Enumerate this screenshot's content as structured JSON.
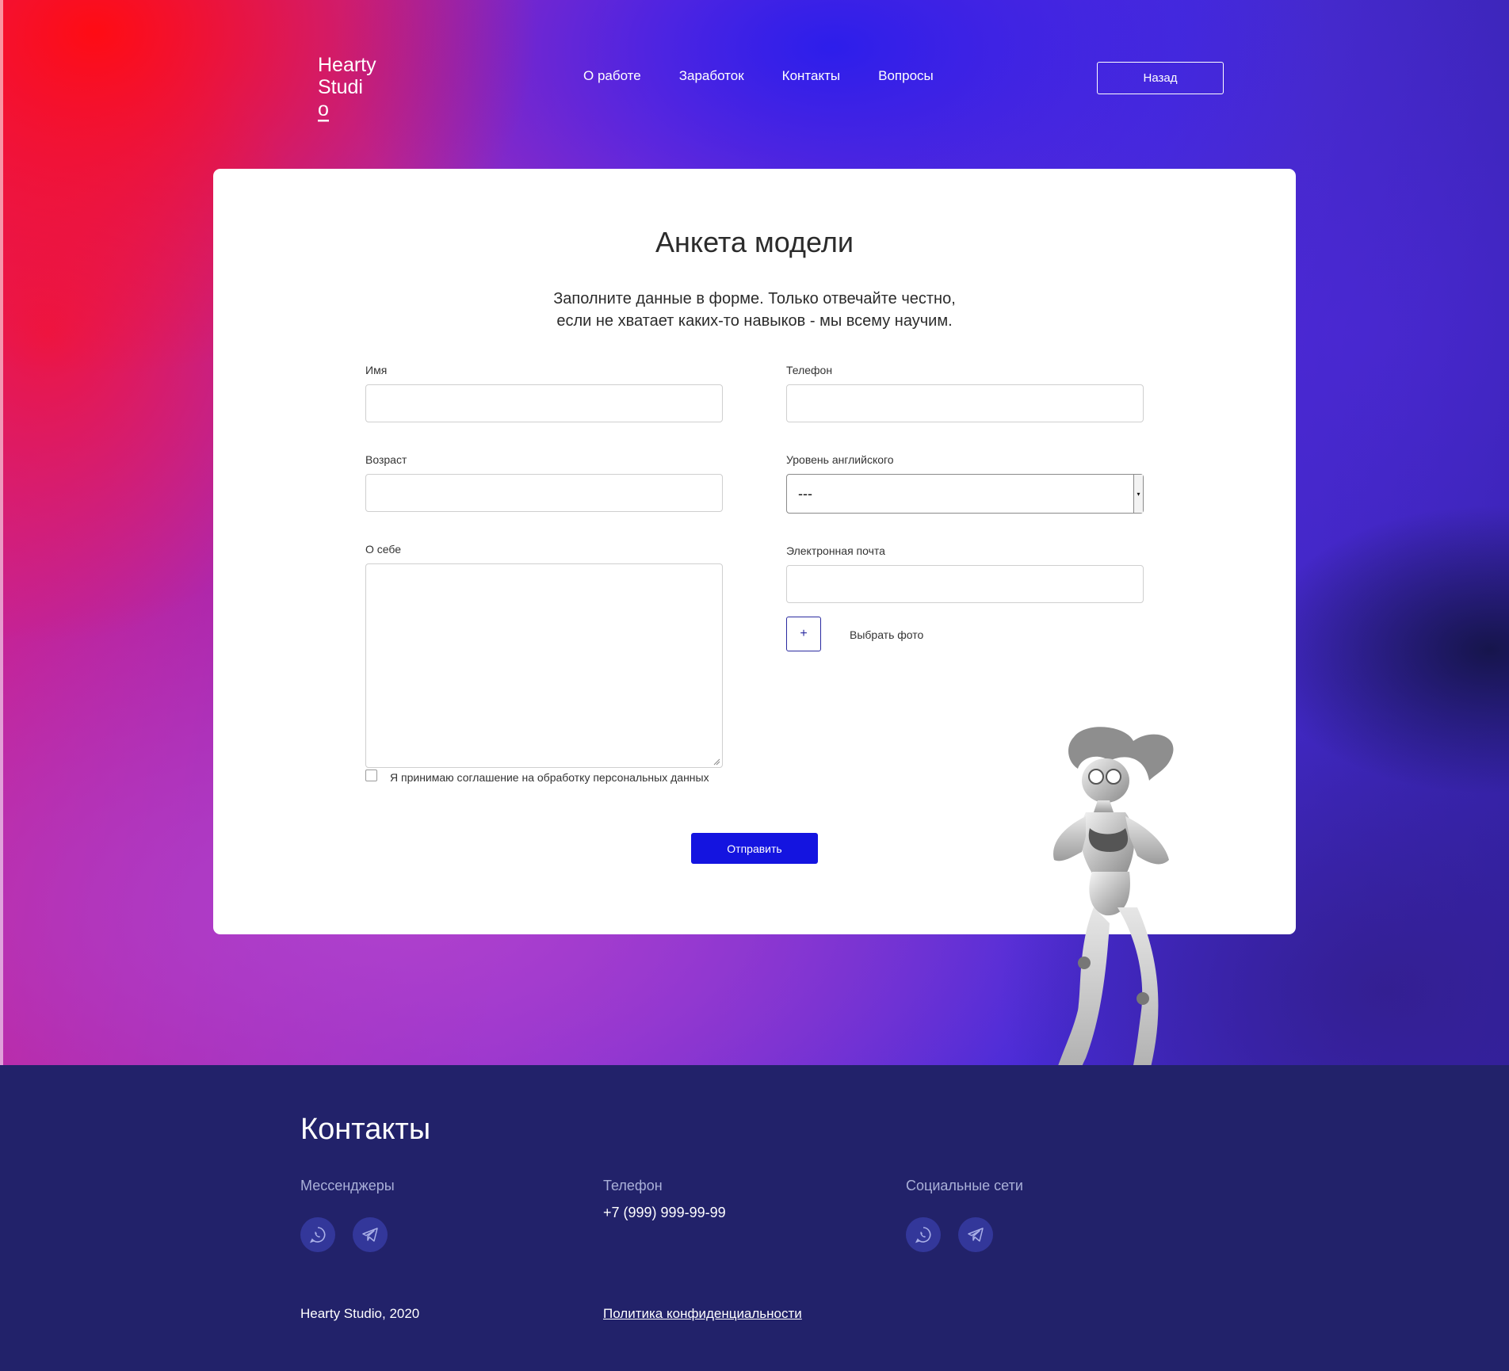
{
  "header": {
    "logo_line1": "Hearty",
    "logo_line2": "Studi",
    "logo_last_letter": "o",
    "nav": [
      {
        "label": "О работе"
      },
      {
        "label": "Заработок"
      },
      {
        "label": "Контакты"
      },
      {
        "label": "Вопросы"
      }
    ],
    "back_label": "Назад"
  },
  "form": {
    "title": "Анкета модели",
    "subtitle_line1": "Заполните данные в форме. Только отвечайте честно,",
    "subtitle_line2": "если не хватает каких-то навыков - мы всему научим.",
    "name_label": "Имя",
    "name_value": "",
    "phone_label": "Телефон",
    "phone_value": "",
    "age_label": "Возраст",
    "age_value": "",
    "english_label": "Уровень английского",
    "english_selected": "---",
    "about_label": "О себе",
    "about_value": "",
    "email_label": "Электронная почта",
    "email_value": "",
    "photo_button": "+",
    "photo_label": "Выбрать фото",
    "consent_label": "Я принимаю соглашение на обработку персональных данных",
    "consent_checked": false,
    "submit_label": "Отправить"
  },
  "footer": {
    "title": "Контакты",
    "messengers_title": "Мессенджеры",
    "phone_title": "Телефон",
    "phone": "+7 (999) 999-99-99",
    "social_title": "Социальные сети",
    "messenger_icons": [
      "whatsapp-icon",
      "telegram-icon"
    ],
    "social_icons": [
      "whatsapp-icon",
      "telegram-icon"
    ],
    "copyright": "Hearty Studio, 2020",
    "policy_link": "Политика конфиденциальности"
  },
  "colors": {
    "accent": "#1414e0",
    "footer_bg": "#22226a",
    "social_bg": "#33379a"
  }
}
